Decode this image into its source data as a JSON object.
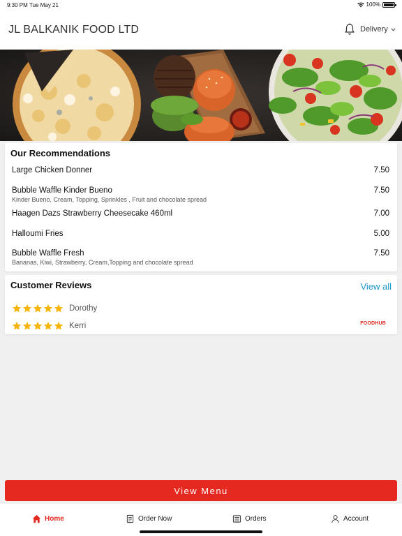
{
  "status_bar": {
    "time": "9:30 PM",
    "date": "Tue May 21",
    "battery": "100%",
    "battery_level": 1.0
  },
  "header": {
    "title": "JL BALKANIK FOOD LTD",
    "delivery_label": "Delivery"
  },
  "recommendations": {
    "title": "Our Recommendations",
    "items": [
      {
        "name": "Large Chicken Donner",
        "description": "",
        "price": "7.50"
      },
      {
        "name": "Bubble Waffle Kinder Bueno",
        "description": "Kinder Bueno, Cream, Topping, Sprinkles , Fruit and chocolate spread",
        "price": "7.50"
      },
      {
        "name": "Haagen Dazs Strawberry Cheesecake 460ml",
        "description": "",
        "price": "7.00"
      },
      {
        "name": "Halloumi Fries",
        "description": "",
        "price": "5.00"
      },
      {
        "name": "Bubble Waffle Fresh",
        "description": "Bananas, Kiwi, Strawberry, Cream,Topping and chocolate spread",
        "price": "7.50"
      }
    ]
  },
  "reviews": {
    "title": "Customer Reviews",
    "view_all": "View all",
    "items": [
      {
        "name": "Dorothy",
        "rating": 5
      },
      {
        "name": "Kerri",
        "rating": 5
      }
    ],
    "source_logo": "FOODHUB"
  },
  "view_menu_label": "View Menu",
  "bottom_nav": {
    "items": [
      {
        "label": "Home",
        "icon": "home-icon",
        "active": true
      },
      {
        "label": "Order Now",
        "icon": "order-now-icon",
        "active": false
      },
      {
        "label": "Orders",
        "icon": "orders-icon",
        "active": false
      },
      {
        "label": "Account",
        "icon": "account-icon",
        "active": false
      }
    ]
  },
  "colors": {
    "accent": "#e52920",
    "link": "#2196c8",
    "star": "#f5b50a"
  }
}
